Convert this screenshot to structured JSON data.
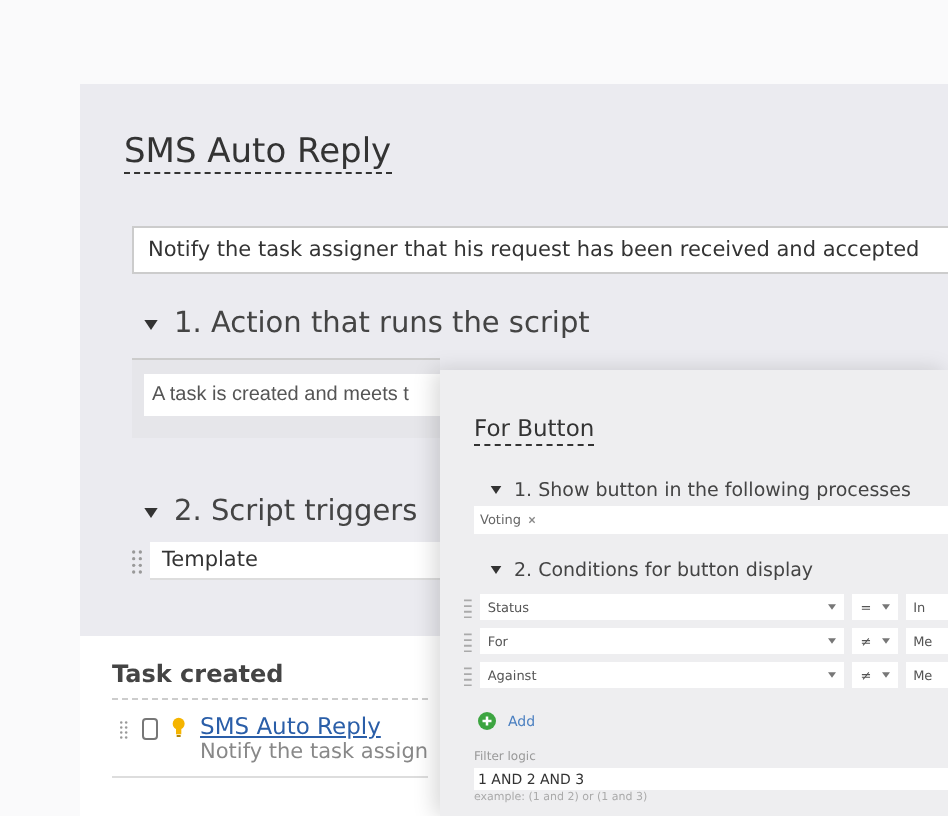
{
  "script_window": {
    "title": "SMS Auto Reply",
    "description": "Notify the task assigner that his request has been received and accepted",
    "sections": [
      {
        "title": "1. Action that runs the script",
        "expanded": true,
        "action": "A task is created and meets t"
      },
      {
        "title": "2. Script triggers",
        "expanded": true,
        "triggers": [
          "Template"
        ]
      }
    ]
  },
  "task_card": {
    "title": "Task created",
    "items": [
      {
        "checked": false,
        "name": "SMS Auto Reply",
        "description": "Notify the task assign"
      }
    ]
  },
  "button_window": {
    "title": "For Button",
    "processes_section": {
      "title": "1. Show button in the following processes",
      "expanded": true,
      "chips": [
        "Voting"
      ]
    },
    "conditions_section": {
      "title": "2. Conditions for button display",
      "expanded": true,
      "conditions": [
        {
          "field": "Status",
          "operator": "=",
          "value": "In"
        },
        {
          "field": "For",
          "operator": "≠",
          "value": "Me"
        },
        {
          "field": "Against",
          "operator": "≠",
          "value": "Me"
        }
      ]
    },
    "add_label": "Add",
    "filter_logic_label": "Filter logic",
    "filter_logic": "1 AND 2 AND 3",
    "example": "example: (1 and 2) or (1 and 3)"
  }
}
